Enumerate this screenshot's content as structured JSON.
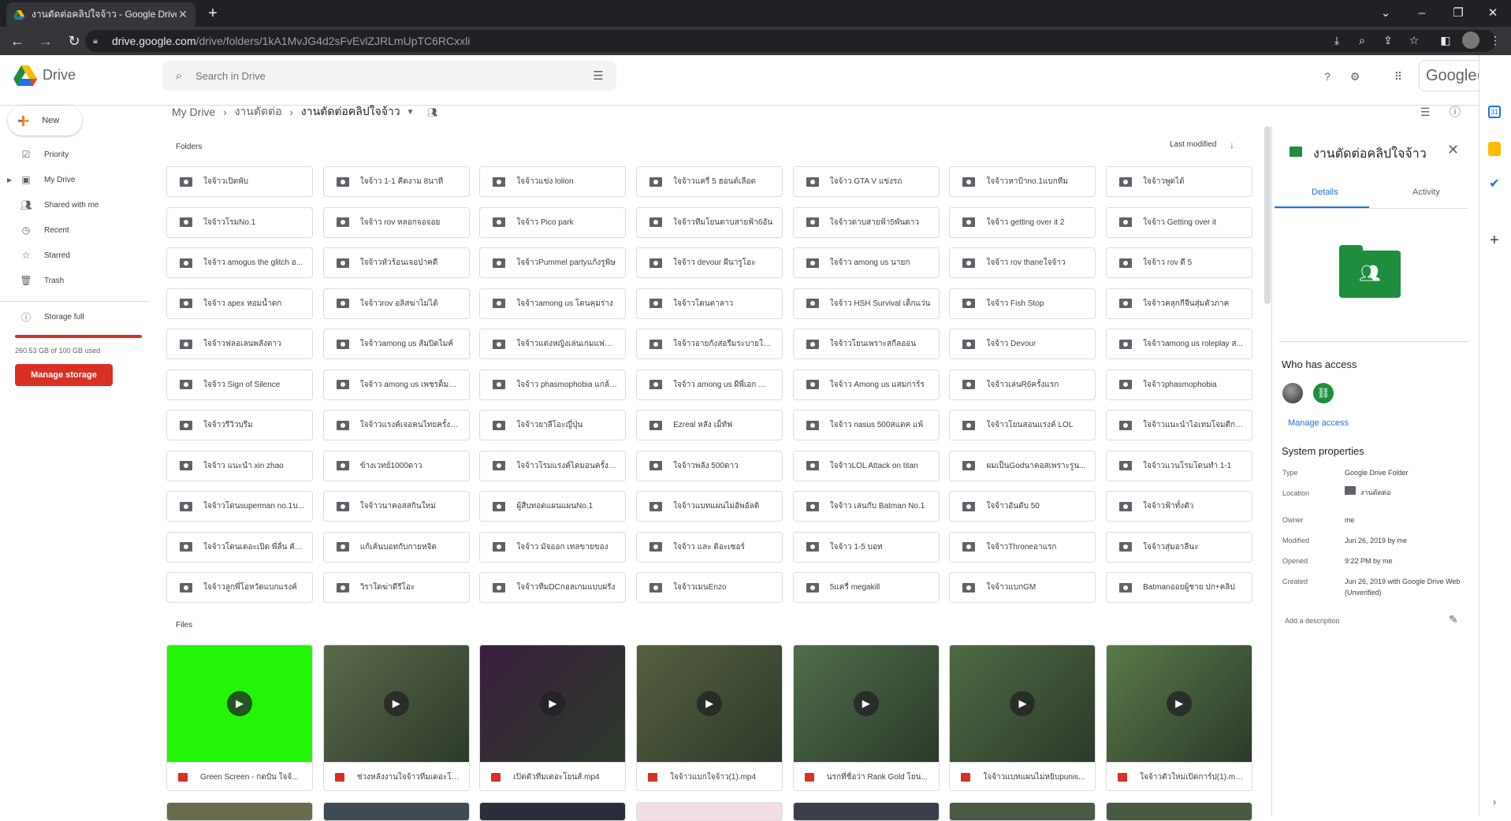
{
  "browser": {
    "tab_title": "งานตัดต่อคลิปใจจ้าว - Google Drive",
    "url_host": "drive.google.com",
    "url_path": "/drive/folders/1kA1MvJG4d2sFvEvlZJRLmUpTC6RCxxli"
  },
  "app": {
    "brand": "Drive",
    "search_placeholder": "Search in Drive",
    "google_word": "Google"
  },
  "sidebar": {
    "new_label": "New",
    "items": [
      {
        "label": "Priority"
      },
      {
        "label": "My Drive"
      },
      {
        "label": "Shared with me"
      },
      {
        "label": "Recent"
      },
      {
        "label": "Starred"
      },
      {
        "label": "Trash"
      }
    ],
    "storage_label": "Storage full",
    "storage_used_text": "260.53 GB of 100 GB used",
    "storage_fill": 1.0,
    "manage_storage": "Manage storage"
  },
  "breadcrumbs": {
    "root": "My Drive",
    "parent": "งานตัดต่อ",
    "current": "งานตัดต่อคลิปใจจ้าว"
  },
  "main": {
    "folders_label": "Folders",
    "sort_label": "Last modified",
    "files_label": "Files",
    "folders": [
      "ใจจ้าวเปิดพับ",
      "ใจจ้าว 1-1 คีดงาม 8นาที",
      "ใจจ้าวแข่ง lolion",
      "ใจจ้าวแครี่ 5 ฮอนต์เลือด",
      "ใจจ้าว GTA V แข่งรถ",
      "ใจจ้าวหาป้าno.1แบกทีม",
      "ใจจ้าวพูดได้",
      "ใจจ้าวโรมNo.1",
      "ใจจ้าว rov หลอกจอจอย",
      "ใจจ้าว Pico park",
      "ใจจ้าวทีมโยนดาบสายฟ้า6อัน",
      "ใจจ้าวดาบสายฟ้า5พันดาว",
      "ใจจ้าว getting over it 2",
      "ใจจ้าว Getting over it",
      "ใจจ้าว amogus the glitch อ...",
      "ใจจ้าวหัวร้อนเจอป่าคดี",
      "ใจจ้าวPummel partyแก้งรูพิษ",
      "ใจจ้าว devour ผีนารูโอะ",
      "ใจจ้าว among us นายก",
      "ใจจ้าว rov thaneใจจ้าว",
      "ใจจ้าว rov ดี 5",
      "ใจจ้าว apex หอมน้ำตก",
      "ใจจ้าวrov อลิสฆ่าไม่ได้",
      "ใจจ้าวamong us โดนคุมร่าง",
      "ใจจ้าวโดนตาลาว",
      "ใจจ้าว HSH Survival เด็กแว่น",
      "ใจจ้าว Fish Stop",
      "ใจจ้าวคลุกกีจีนสุ่มตัวภาค",
      "ใจจ้าวฟลอเลนพลังดาว",
      "ใจจ้าวamong us ส้มปิดไมค์",
      "ใจจ้าวแต่งหญิงเล่นเกมแฟช่อ...",
      "ใจจ้าวอายกังสอรีมระบายใน...",
      "ใจจ้าวโยนเพราะสกีลออน",
      "ใจจ้าว Devour",
      "ใจจ้าวamong us roleplay ส...",
      "ใจจ้าว Sign of Silence",
      "ใจจ้าว among us เพชรต็มากั...",
      "ใจจ้าว phasmophobia แกล้ง...",
      "ใจจ้าว among us ผีพี่เอก น้ำ...",
      "ใจจ้าว Among us แสมการ์ร",
      "ใจจ้าวเล่นR6ครั้งแรก",
      "ใจจ้าวphasmophobia",
      "ใจจ้าวรีวิวบรีม",
      "ใจจ้าวแรงค์เจอคนไทยครั้งแรก",
      "ใจจ้าวยาลีโอะญี่ปุ่น",
      "Ezreal หลัง เม็ทัฟ",
      "ใจจ้าว nasus 500สแตค แพ้",
      "ใจจ้าวโยนสอนแรงค์ LOL",
      "ใจจ้าวแนะนำไอเทมโจมตีกาย...",
      "ใจจ้าว แนะนำ xin zhao",
      "ข้างเวทย์1000ดาว",
      "ใจจ้าวโรมแรงค์ไดมอนครั้งแรก",
      "ใจจ้าวพลัง 500ดาว",
      "ใจจ้าวLOL Attack on titan",
      "ผมเป็นGodนาคอสเพราะรูน...",
      "ใจจ้าวแวนโรมโดนทำ 1-1",
      "ใจจ้าวโดนsuperman no.1บ...",
      "ใจจ้าวนาคอสสกินใหม่",
      "ผู้สืบทอดแผนแผนNo.1",
      "ใจจ้าวแบทแผนไม่อัพอัลติ",
      "ใจจ้าว เล่นกับ Batman No.1",
      "ใจจ้าวอันดับ 50",
      "ใจจ้าวฟ้าทั้งตัว",
      "ใจจ้าวโดนเดอะเปิด พี่ลื่น คัก...",
      "แก้เค้นบอทกับกายหจิด",
      "ใจจ้าว มัจออก เทลขายของ",
      "ใจจ้าว และ ดิอะเซอร์",
      "ใจจ้าว 1-5 บอท",
      "ใจจ้าวThroneอาแรก",
      "ใจจ้าวสุ่มอาลีนะ",
      "ใจจ้าวลูกพี่โอหวัดแบกแรงค์",
      "วิราใดฆ่าดีรีโอะ",
      "ใจจ้าวทีมDCกอลเกมแบบฝรั่ง",
      "ใจจ้าวเมนEnzo",
      "5แครี่ megakill",
      "ใจจ้าวแบกGM",
      "Batmanออยผู้ชาย ปก+คลิป"
    ],
    "files": [
      {
        "name": "Green Screen - กดปั่น ใจจ้...",
        "thumb": "#23f507"
      },
      {
        "name": "ช่วงหลังงานใจจ้าวทีมเดอะโย...",
        "thumb": "#5b6a4a"
      },
      {
        "name": "เปิดตัวทีมเดอะโยนส์.mp4",
        "thumb": "#3a1f3e"
      },
      {
        "name": "ใจจ้าวแบกใจจ้าว(1).mp4",
        "thumb": "#56603f"
      },
      {
        "name": "นรกที่ชื่อว่า Rank Gold โยน...",
        "thumb": "#4f6d4a"
      },
      {
        "name": "ใจจ้าวแบทแผนไม่หยิบpunis...",
        "thumb": "#4f6a43"
      },
      {
        "name": "ใจจ้าวตัวใหม่เปิดการ์ป(1).mp4",
        "thumb": "#597a49"
      }
    ],
    "files_row2_thumbs": [
      "#6a6a4c",
      "#3d4a52",
      "#2a2d3a",
      "#f3dde4",
      "#3a3f4a",
      "#4a5a45",
      "#485a3f"
    ]
  },
  "details_panel": {
    "title": "งานตัดต่อคลิปใจจ้าว",
    "tab_details": "Details",
    "tab_activity": "Activity",
    "who_has_access": "Who has access",
    "manage_access": "Manage access",
    "system_properties": "System properties",
    "props": [
      {
        "key": "Type",
        "value": "Google Drive Folder"
      },
      {
        "key": "Location",
        "value": "งานตัดต่อ"
      },
      {
        "key": "Owner",
        "value": "me"
      },
      {
        "key": "Modified",
        "value": "Jun 26, 2019 by me"
      },
      {
        "key": "Opened",
        "value": "9:22 PM by me"
      },
      {
        "key": "Created",
        "value": "Jun 26, 2019 with Google Drive Web (Unverified)"
      }
    ],
    "add_description": "Add a description"
  },
  "colors": {
    "accent": "#1a73e8",
    "danger": "#d93025",
    "folder_green": "#1e8e3e"
  }
}
